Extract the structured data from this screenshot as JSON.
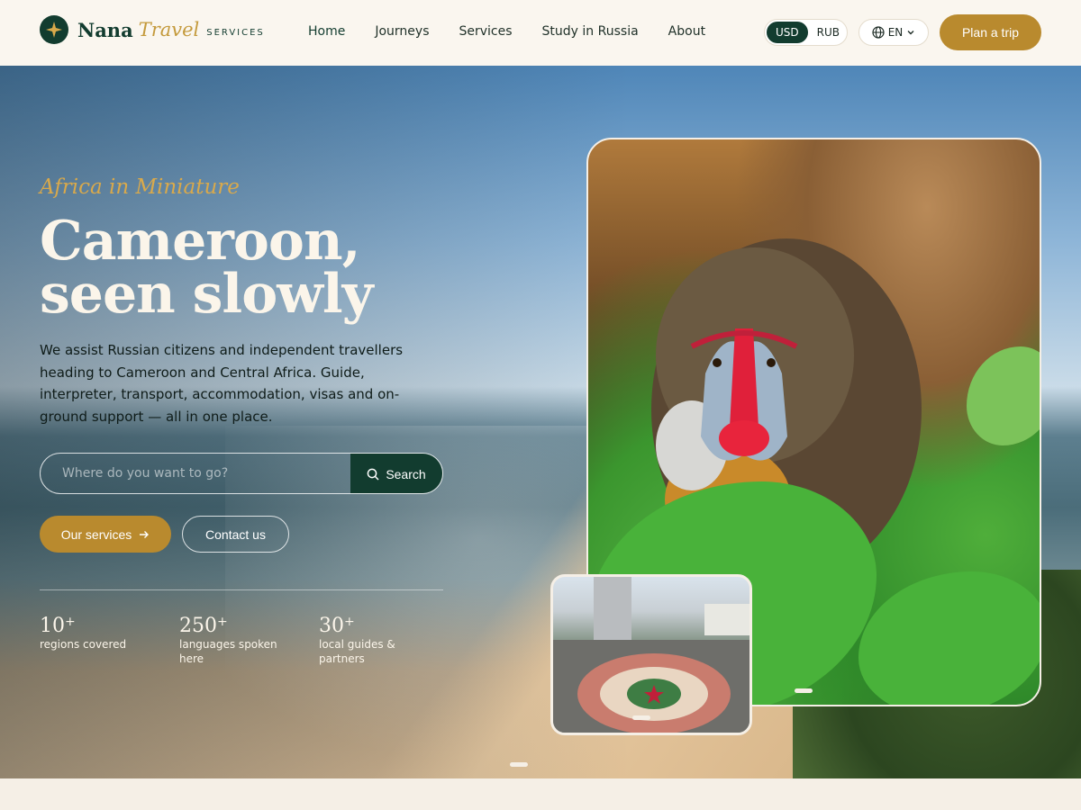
{
  "brand": {
    "name": "Nana",
    "travel": "Travel",
    "sub": "SERVICES"
  },
  "nav": {
    "items": [
      "Home",
      "Journeys",
      "Services",
      "Study in Russia",
      "About"
    ]
  },
  "currency": {
    "options": [
      "USD",
      "RUB"
    ],
    "selected": "USD"
  },
  "language": {
    "label": "EN"
  },
  "cta": {
    "plan": "Plan a trip"
  },
  "hero": {
    "eyebrow": "Africa in Miniature",
    "title": "Cameroon, seen slowly",
    "lead": "We assist Russian citizens and independent travellers heading to Cameroon and Central Africa. Guide, interpreter, transport, accommodation, visas and on-ground support — all in one place.",
    "search_placeholder": "Where do you want to go?",
    "search_label": "Search",
    "services_label": "Our services",
    "contact_label": "Contact us",
    "stats": [
      {
        "num": "10",
        "plus": "+",
        "label": "regions covered"
      },
      {
        "num": "250",
        "plus": "+",
        "label": "languages spoken here"
      },
      {
        "num": "30",
        "plus": "+",
        "label": "local guides & partners"
      }
    ]
  },
  "colors": {
    "accent": "#b98a2e",
    "brand": "#123c2f",
    "cream": "#f5efe6"
  }
}
